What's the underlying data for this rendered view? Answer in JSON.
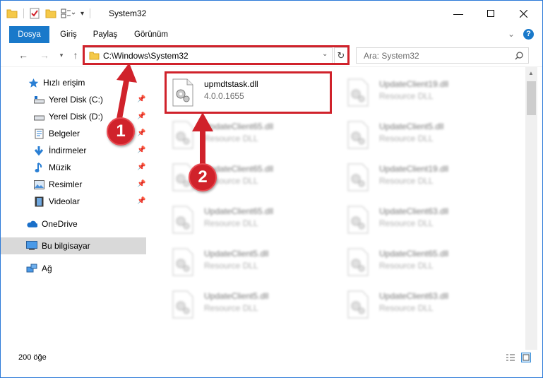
{
  "window": {
    "title": "System32"
  },
  "ribbon": {
    "tabs": [
      {
        "label": "Dosya",
        "active": true
      },
      {
        "label": "Giriş",
        "active": false
      },
      {
        "label": "Paylaş",
        "active": false
      },
      {
        "label": "Görünüm",
        "active": false
      }
    ]
  },
  "address": {
    "path": "C:\\Windows\\System32",
    "search_placeholder": "Ara: System32"
  },
  "nav": {
    "items": [
      {
        "label": "Hızlı erişim",
        "icon": "star-icon",
        "pinned": false
      },
      {
        "label": "Yerel Disk (C:)",
        "icon": "drive-icon",
        "pinned": true
      },
      {
        "label": "Yerel Disk (D:)",
        "icon": "drive-icon",
        "pinned": true
      },
      {
        "label": "Belgeler",
        "icon": "documents-icon",
        "pinned": true
      },
      {
        "label": "İndirmeler",
        "icon": "download-icon",
        "pinned": true
      },
      {
        "label": "Müzik",
        "icon": "music-icon",
        "pinned": true
      },
      {
        "label": "Resimler",
        "icon": "pictures-icon",
        "pinned": true
      },
      {
        "label": "Videolar",
        "icon": "videos-icon",
        "pinned": true
      },
      {
        "label": "OneDrive",
        "icon": "cloud-icon",
        "pinned": false
      },
      {
        "label": "Bu bilgisayar",
        "icon": "computer-icon",
        "pinned": false,
        "selected": true
      },
      {
        "label": "Ağ",
        "icon": "network-icon",
        "pinned": false
      }
    ]
  },
  "files": [
    {
      "name": "upmdtstask.dll",
      "sub": "4.0.0.1655",
      "blurred": false
    },
    {
      "name": "UpdateClient19.dll",
      "sub": "Resource DLL",
      "blurred": true
    },
    {
      "name": "UpdateClient65.dll",
      "sub": "Resource DLL",
      "blurred": true
    },
    {
      "name": "UpdateClient5.dll",
      "sub": "Resource DLL",
      "blurred": true
    },
    {
      "name": "UpdateClient65.dll",
      "sub": "Resource DLL",
      "blurred": true
    },
    {
      "name": "UpdateClient19.dll",
      "sub": "Resource DLL",
      "blurred": true
    },
    {
      "name": "UpdateClient65.dll",
      "sub": "Resource DLL",
      "blurred": true
    },
    {
      "name": "UpdateClient63.dll",
      "sub": "Resource DLL",
      "blurred": true
    },
    {
      "name": "UpdateClient5.dll",
      "sub": "Resource DLL",
      "blurred": true
    },
    {
      "name": "UpdateClient65.dll",
      "sub": "Resource DLL",
      "blurred": true
    },
    {
      "name": "UpdateClient5.dll",
      "sub": "Resource DLL",
      "blurred": true
    },
    {
      "name": "UpdateClient63.dll",
      "sub": "Resource DLL",
      "blurred": true
    }
  ],
  "status": {
    "count": "200 öğe"
  },
  "annotations": {
    "step1": "1",
    "step2": "2",
    "color": "#d0222b"
  }
}
